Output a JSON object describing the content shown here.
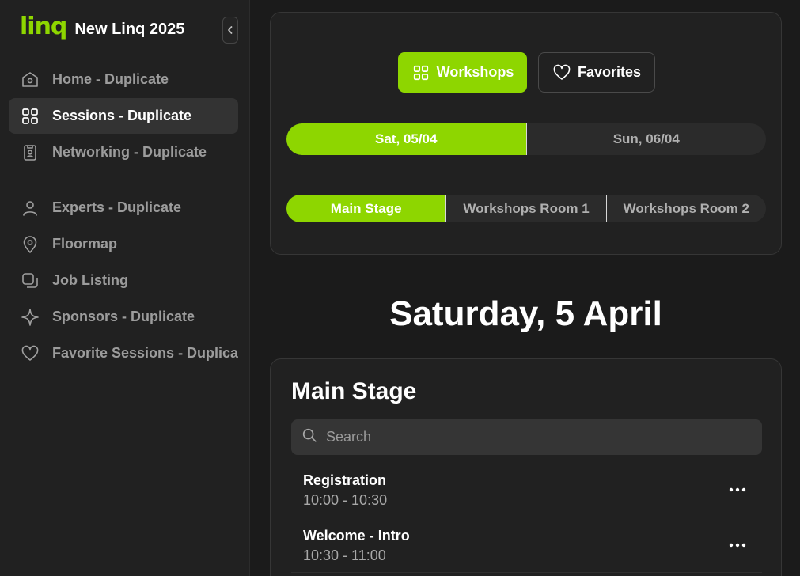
{
  "app": {
    "logo_text": "linq",
    "name": "New Linq 2025"
  },
  "sidebar": {
    "items": [
      {
        "label": "Home - Duplicate",
        "icon": "home-icon",
        "active": false
      },
      {
        "label": "Sessions - Duplicate",
        "icon": "grid-icon",
        "active": true
      },
      {
        "label": "Networking - Duplicate",
        "icon": "badge-icon",
        "active": false
      },
      {
        "label": "Experts - Duplicate",
        "icon": "user-icon",
        "active": false
      },
      {
        "label": "Floormap",
        "icon": "map-pin-icon",
        "active": false
      },
      {
        "label": "Job Listing",
        "icon": "job-listing-icon",
        "active": false
      },
      {
        "label": "Sponsors - Duplicate",
        "icon": "sparkle-icon",
        "active": false
      },
      {
        "label": "Favorite Sessions - Duplicate",
        "icon": "heart-icon",
        "active": false
      }
    ]
  },
  "view_toggle": {
    "workshops_label": "Workshops",
    "favorites_label": "Favorites"
  },
  "days": [
    {
      "label": "Sat, 05/04",
      "active": true
    },
    {
      "label": "Sun, 06/04",
      "active": false
    }
  ],
  "rooms": [
    {
      "label": "Main Stage",
      "active": true
    },
    {
      "label": "Workshops Room 1",
      "active": false
    },
    {
      "label": "Workshops Room 2",
      "active": false
    }
  ],
  "day_heading": "Saturday, 5 April",
  "sessions_panel": {
    "room_title": "Main Stage",
    "search_placeholder": "Search",
    "sessions": [
      {
        "title": "Registration",
        "time": "10:00 - 10:30"
      },
      {
        "title": "Welcome - Intro",
        "time": "10:30 - 11:00"
      }
    ]
  },
  "colors": {
    "accent": "#8ed600",
    "background": "#1b1b1b",
    "panel": "#212121"
  }
}
